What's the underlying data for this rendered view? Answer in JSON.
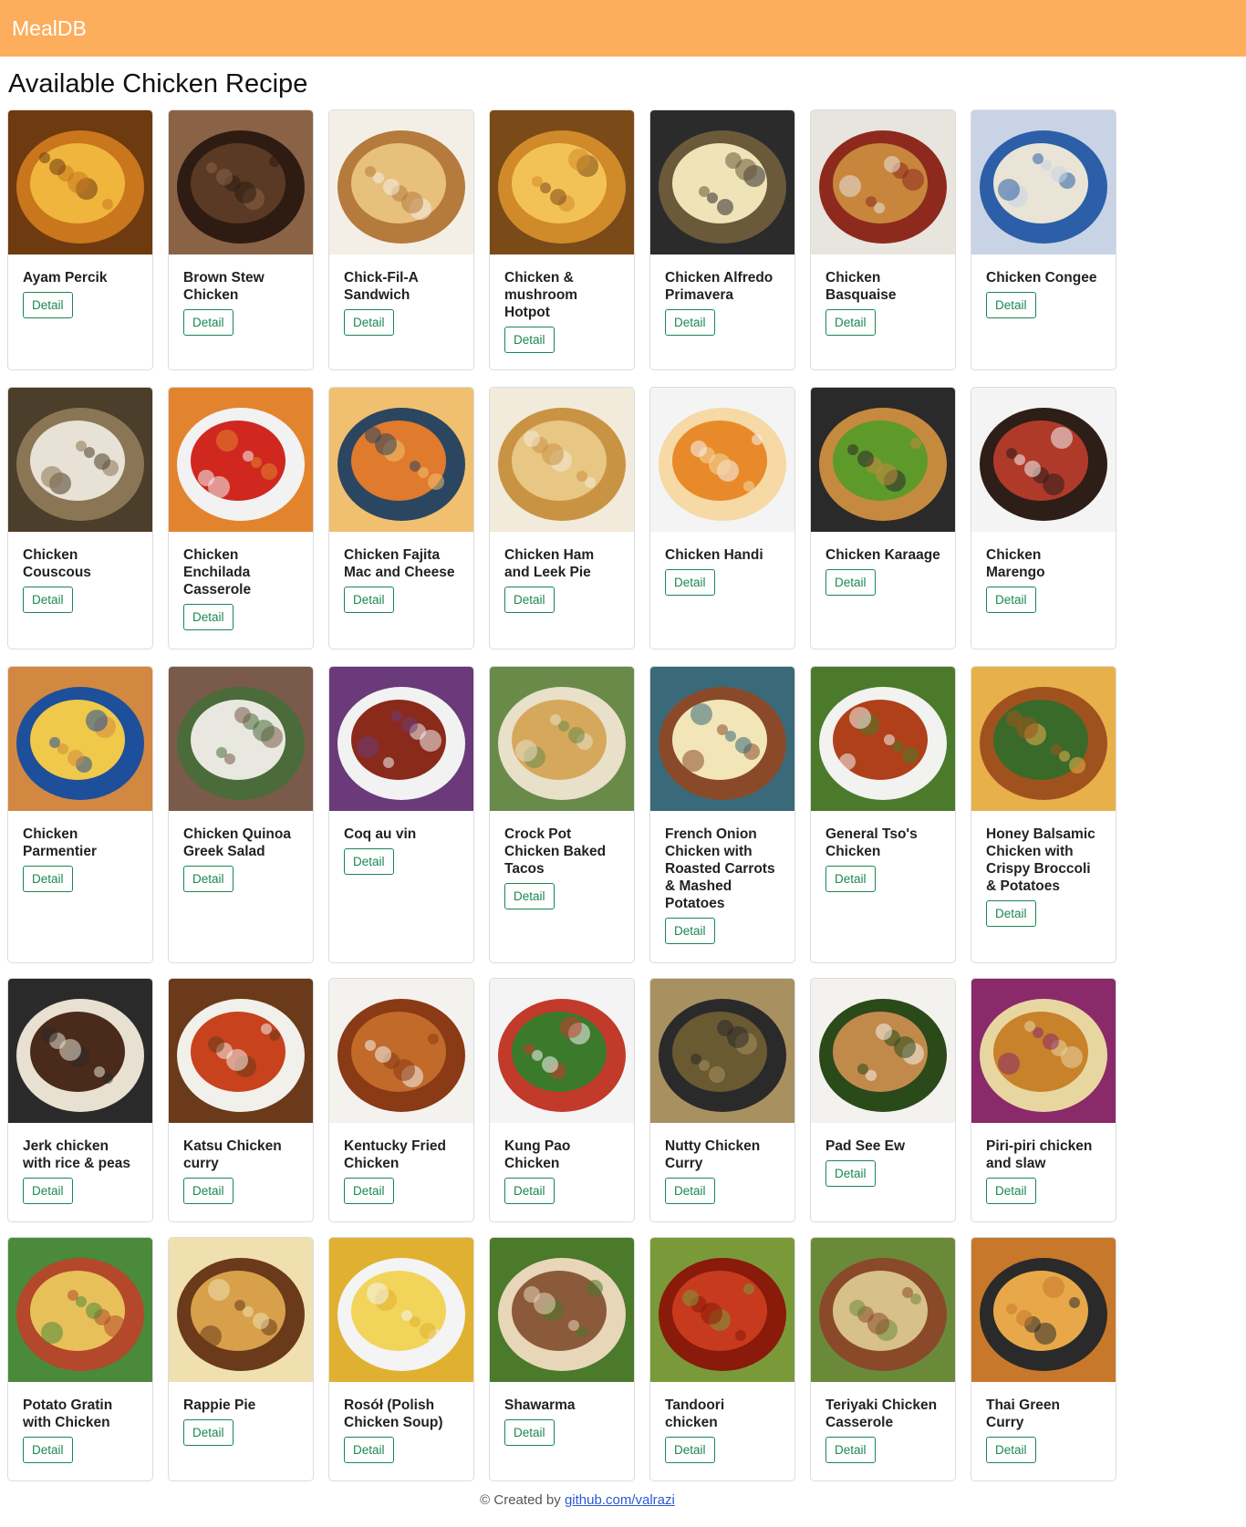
{
  "navbar": {
    "brand": "MealDB"
  },
  "page_title": "Available Chicken Recipe",
  "detail_label": "Detail",
  "recipes": [
    {
      "title": "Ayam Percik",
      "colors": [
        "#f0b53c",
        "#c9761d",
        "#6e3a10"
      ]
    },
    {
      "title": "Brown Stew Chicken",
      "colors": [
        "#5a3a24",
        "#2e1c12",
        "#8a6246"
      ]
    },
    {
      "title": "Chick-Fil-A Sandwich",
      "colors": [
        "#e8c07e",
        "#b57b3c",
        "#f4efe6"
      ]
    },
    {
      "title": "Chicken & mushroom Hotpot",
      "colors": [
        "#f3c257",
        "#d08a2a",
        "#7a4a18"
      ]
    },
    {
      "title": "Chicken Alfredo Primavera",
      "colors": [
        "#efe3b8",
        "#6a5a3a",
        "#2b2b2b"
      ]
    },
    {
      "title": "Chicken Basquaise",
      "colors": [
        "#c7863c",
        "#8e2a1d",
        "#e8e4de"
      ]
    },
    {
      "title": "Chicken Congee",
      "colors": [
        "#e9e4d5",
        "#2c5fa8",
        "#c9d3e6"
      ]
    },
    {
      "title": "Chicken Couscous",
      "colors": [
        "#e8e2d6",
        "#8a7654",
        "#4b3e2a"
      ]
    },
    {
      "title": "Chicken Enchilada Casserole",
      "colors": [
        "#d0281f",
        "#f2f2f2",
        "#e2842e"
      ]
    },
    {
      "title": "Chicken Fajita Mac and Cheese",
      "colors": [
        "#e07a2c",
        "#2b4660",
        "#f0c070"
      ]
    },
    {
      "title": "Chicken Ham and Leek Pie",
      "colors": [
        "#e8c684",
        "#c89444",
        "#f2ebdb"
      ]
    },
    {
      "title": "Chicken Handi",
      "colors": [
        "#e88a2a",
        "#f6d9a4",
        "#f4f4f4"
      ]
    },
    {
      "title": "Chicken Karaage",
      "colors": [
        "#5e9a2a",
        "#c58a3e",
        "#2a2a2a"
      ]
    },
    {
      "title": "Chicken Marengo",
      "colors": [
        "#b03a2a",
        "#2e1e18",
        "#f4f4f4"
      ]
    },
    {
      "title": "Chicken Parmentier",
      "colors": [
        "#f0c94a",
        "#1e4f9a",
        "#d28840"
      ]
    },
    {
      "title": "Chicken Quinoa Greek Salad",
      "colors": [
        "#e8e8e0",
        "#4b6b3a",
        "#7a5a4a"
      ]
    },
    {
      "title": "Coq au vin",
      "colors": [
        "#8a2a1a",
        "#f2f2f2",
        "#6a3a7a"
      ]
    },
    {
      "title": "Crock Pot Chicken Baked Tacos",
      "colors": [
        "#d6a85c",
        "#e8e0c8",
        "#6a8a4a"
      ]
    },
    {
      "title": "French Onion Chicken with Roasted Carrots & Mashed Potatoes",
      "colors": [
        "#f2e6b8",
        "#8a4a2a",
        "#3a6a7a"
      ]
    },
    {
      "title": "General Tso's Chicken",
      "colors": [
        "#b0401a",
        "#f2f2f0",
        "#4a7a2a"
      ]
    },
    {
      "title": "Honey Balsamic Chicken with Crispy Broccoli & Potatoes",
      "colors": [
        "#3a6a2a",
        "#a0521e",
        "#e8b04a"
      ]
    },
    {
      "title": "Jerk chicken with rice & peas",
      "colors": [
        "#4a2a1a",
        "#e8e0d0",
        "#2a2a2a"
      ]
    },
    {
      "title": "Katsu Chicken curry",
      "colors": [
        "#c8421e",
        "#f2f0ea",
        "#6a3a1a"
      ]
    },
    {
      "title": "Kentucky Fried Chicken",
      "colors": [
        "#c26a2a",
        "#8a3a14",
        "#f4f2ee"
      ]
    },
    {
      "title": "Kung Pao Chicken",
      "colors": [
        "#3a7a2a",
        "#c23a2a",
        "#f4f4f4"
      ]
    },
    {
      "title": "Nutty Chicken Curry",
      "colors": [
        "#6a5a32",
        "#2a2a2a",
        "#a89060"
      ]
    },
    {
      "title": "Pad See Ew",
      "colors": [
        "#c28a4a",
        "#2a4a1a",
        "#f4f2ee"
      ]
    },
    {
      "title": "Piri-piri chicken and slaw",
      "colors": [
        "#c8822a",
        "#e8d6a0",
        "#8a2a6a"
      ]
    },
    {
      "title": "Potato Gratin with Chicken",
      "colors": [
        "#e8c05a",
        "#b4482a",
        "#4a8a3a"
      ]
    },
    {
      "title": "Rappie Pie",
      "colors": [
        "#d8a04a",
        "#6a3a1a",
        "#f0e0b0"
      ]
    },
    {
      "title": "Rosół (Polish Chicken Soup)",
      "colors": [
        "#f2d45a",
        "#f4f4f4",
        "#e0b030"
      ]
    },
    {
      "title": "Shawarma",
      "colors": [
        "#8a5a3a",
        "#e8d6b8",
        "#4a7a2a"
      ]
    },
    {
      "title": "Tandoori chicken",
      "colors": [
        "#c83a1e",
        "#8a1a0a",
        "#7a9a3a"
      ]
    },
    {
      "title": "Teriyaki Chicken Casserole",
      "colors": [
        "#d8c08a",
        "#8a4a2a",
        "#6a8a3a"
      ]
    },
    {
      "title": "Thai Green Curry",
      "colors": [
        "#e8a84a",
        "#2a2a2a",
        "#c8782a"
      ]
    }
  ],
  "footer": {
    "prefix": "© Created by ",
    "link_text": "github.com/valrazi"
  }
}
